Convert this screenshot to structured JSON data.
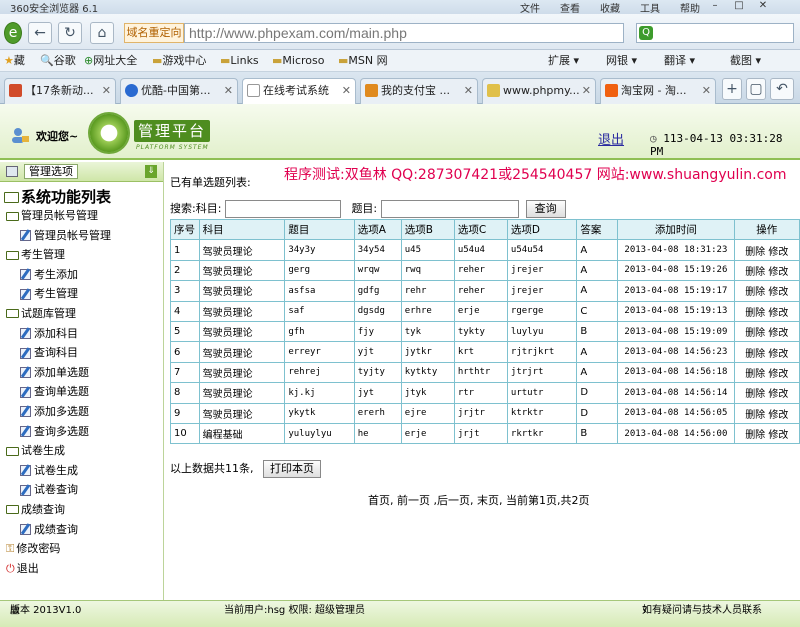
{
  "browser": {
    "app_title": "360安全浏览器 6.1",
    "menus": [
      "文件",
      "查看",
      "收藏",
      "工具",
      "帮助"
    ],
    "redirect_label": "域名重定向",
    "url": "http://www.phpexam.com/main.php",
    "favorites": [
      "藏",
      "谷歌",
      "网址大全",
      "游戏中心",
      "Links",
      "Microso",
      "MSN 网"
    ],
    "toolbar_right": [
      "扩展",
      "网银",
      "翻译",
      "截图"
    ],
    "tabs": [
      {
        "label": "【17条新动...",
        "color": "#d14b2a"
      },
      {
        "label": "优酷-中国第...",
        "color": "#2a6ad1"
      },
      {
        "label": "在线考试系统",
        "color": "#cccccc"
      },
      {
        "label": "我的支付宝 ...",
        "color": "#e08a1e"
      },
      {
        "label": "www.phpmy...",
        "color": "#e0c04a"
      },
      {
        "label": "淘宝网 - 淘...",
        "color": "#f06010"
      }
    ]
  },
  "header": {
    "welcome": "欢迎您~",
    "logo_title": "管理平台",
    "logo_sub": "PLATFORM SYSTEM",
    "logout": "退出",
    "datetime": "113-04-13 03:31:28 PM"
  },
  "sidebar": {
    "head_label": "管理选项",
    "root": "系统功能列表",
    "nodes": [
      {
        "level": 0,
        "type": "folder",
        "label": "管理员帐号管理"
      },
      {
        "level": 1,
        "type": "page",
        "label": "管理员帐号管理"
      },
      {
        "level": 0,
        "type": "folder",
        "label": "考生管理"
      },
      {
        "level": 1,
        "type": "page",
        "label": "考生添加"
      },
      {
        "level": 1,
        "type": "page",
        "label": "考生管理"
      },
      {
        "level": 0,
        "type": "folder",
        "label": "试题库管理"
      },
      {
        "level": 1,
        "type": "page",
        "label": "添加科目"
      },
      {
        "level": 1,
        "type": "page",
        "label": "查询科目"
      },
      {
        "level": 1,
        "type": "page",
        "label": "添加单选题"
      },
      {
        "level": 1,
        "type": "page",
        "label": "查询单选题"
      },
      {
        "level": 1,
        "type": "page",
        "label": "添加多选题"
      },
      {
        "level": 1,
        "type": "page",
        "label": "查询多选题"
      },
      {
        "level": 0,
        "type": "folder",
        "label": "试卷生成"
      },
      {
        "level": 1,
        "type": "page",
        "label": "试卷生成"
      },
      {
        "level": 1,
        "type": "page",
        "label": "试卷查询"
      },
      {
        "level": 0,
        "type": "folder",
        "label": "成绩查询"
      },
      {
        "level": 1,
        "type": "page",
        "label": "成绩查询"
      },
      {
        "level": 0,
        "type": "key",
        "label": "修改密码"
      },
      {
        "level": 0,
        "type": "exit",
        "label": "退出"
      }
    ]
  },
  "content": {
    "list_title": "已有单选题列表:",
    "tester": "程序测试:双鱼林 QQ:287307421或254540457 网站:www.shuangyulin.com",
    "search": {
      "label": "搜索:",
      "subject_label": "科目:",
      "question_label": "题目:",
      "button": "查询"
    },
    "columns": [
      "序号",
      "科目",
      "题目",
      "选项A",
      "选项B",
      "选项C",
      "选项D",
      "答案",
      "添加时间",
      "操作"
    ],
    "rows": [
      [
        "1",
        "驾驶员理论",
        "34y3y",
        "34y54",
        "u45",
        "u54u4",
        "u54u54",
        "A",
        "2013-04-08 18:31:23"
      ],
      [
        "2",
        "驾驶员理论",
        "gerg",
        "wrqw",
        "rwq",
        "reher",
        "jrejer",
        "A",
        "2013-04-08 15:19:26"
      ],
      [
        "3",
        "驾驶员理论",
        "asfsa",
        "gdfg",
        "rehr",
        "reher",
        "jrejer",
        "A",
        "2013-04-08 15:19:17"
      ],
      [
        "4",
        "驾驶员理论",
        "saf",
        "dgsdg",
        "erhre",
        "erje",
        "rgerge",
        "C",
        "2013-04-08 15:19:13"
      ],
      [
        "5",
        "驾驶员理论",
        "gfh",
        "fjy",
        "tyk",
        "tykty",
        "luylyu",
        "B",
        "2013-04-08 15:19:09"
      ],
      [
        "6",
        "驾驶员理论",
        "erreyr",
        "yjt",
        "jytkr",
        "krt",
        "rjtrjkrt",
        "A",
        "2013-04-08 14:56:23"
      ],
      [
        "7",
        "驾驶员理论",
        "rehrej",
        "tyjty",
        "kytkty",
        "hrthtr",
        "jtrjrt",
        "A",
        "2013-04-08 14:56:18"
      ],
      [
        "8",
        "驾驶员理论",
        "kj.kj",
        "jyt",
        "jtyk",
        "rtr",
        "urtutr",
        "D",
        "2013-04-08 14:56:14"
      ],
      [
        "9",
        "驾驶员理论",
        "ykytk",
        "ererh",
        "ejre",
        "jrjtr",
        "ktrktr",
        "D",
        "2013-04-08 14:56:05"
      ],
      [
        "10",
        "编程基础",
        "yuluylyu",
        "he",
        "erje",
        "jrjt",
        "rkrtkr",
        "B",
        "2013-04-08 14:56:00"
      ]
    ],
    "op_delete": "删除",
    "op_edit": "修改",
    "summary": "以上数据共11条,",
    "print_button": "打印本页",
    "pager": "首页, 前一页 ,后一页, 末页, 当前第1页,共2页"
  },
  "footer": {
    "version": "版本 2013V1.0",
    "current_user": "当前用户:hsg 权限: 超级管理员",
    "help": "如有疑问请与技术人员联系"
  }
}
